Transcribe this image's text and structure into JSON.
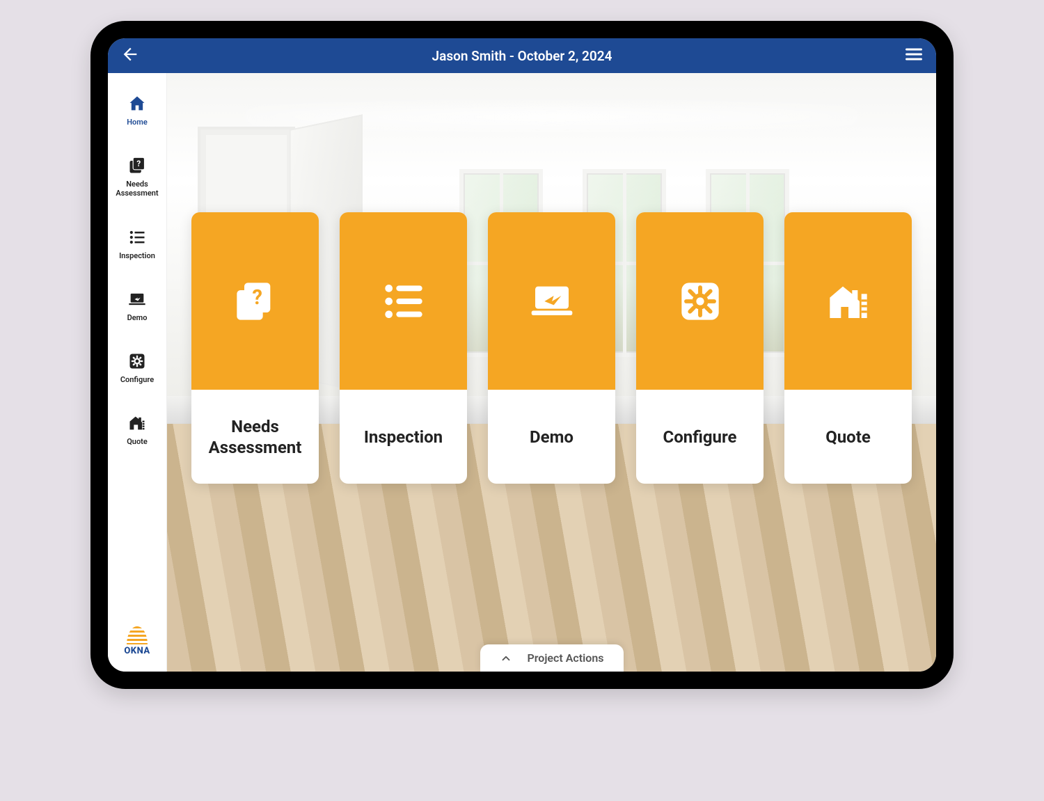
{
  "header": {
    "title": "Jason Smith - October 2, 2024"
  },
  "sidebar": {
    "items": [
      {
        "label": "Home",
        "icon": "home-icon"
      },
      {
        "label": "Needs\nAssessment",
        "icon": "question-stack-icon"
      },
      {
        "label": "Inspection",
        "icon": "list-icon"
      },
      {
        "label": "Demo",
        "icon": "laptop-share-icon"
      },
      {
        "label": "Configure",
        "icon": "gear-box-icon"
      },
      {
        "label": "Quote",
        "icon": "house-plan-icon"
      }
    ],
    "brand": "OKNA"
  },
  "cards": [
    {
      "label": "Needs\nAssessment",
      "icon": "question-stack-icon"
    },
    {
      "label": "Inspection",
      "icon": "list-icon"
    },
    {
      "label": "Demo",
      "icon": "laptop-share-icon"
    },
    {
      "label": "Configure",
      "icon": "gear-box-icon"
    },
    {
      "label": "Quote",
      "icon": "house-plan-icon"
    }
  ],
  "footer": {
    "actions_label": "Project Actions"
  },
  "colors": {
    "primary": "#1e4a94",
    "accent": "#f5a623"
  }
}
